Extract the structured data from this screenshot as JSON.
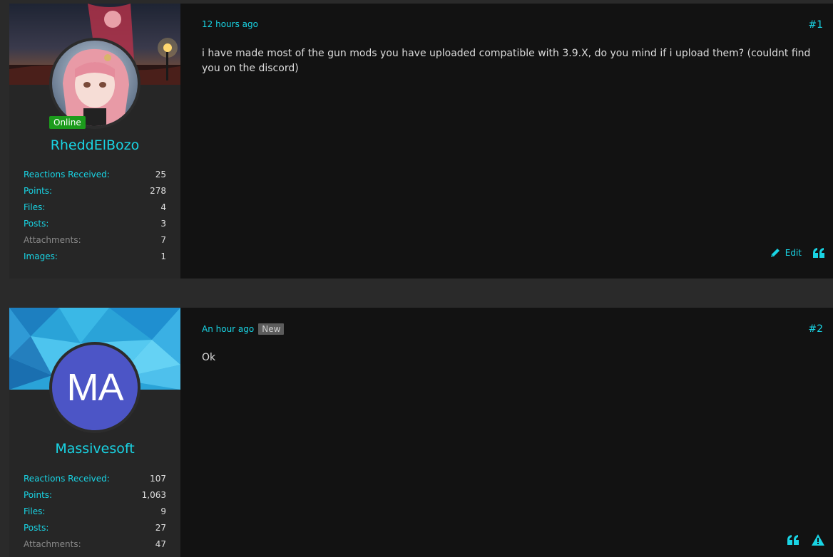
{
  "posts": [
    {
      "user": {
        "name": "RheddElBozo",
        "online_label": "Online",
        "stats": [
          {
            "label": "Reactions Received:",
            "value": "25"
          },
          {
            "label": "Points:",
            "value": "278"
          },
          {
            "label": "Files:",
            "value": "4"
          },
          {
            "label": "Posts:",
            "value": "3"
          },
          {
            "label": "Attachments:",
            "value": "7"
          },
          {
            "label": "Images:",
            "value": "1"
          }
        ]
      },
      "time": "12 hours ago",
      "number": "#1",
      "message": "i have made most of the gun mods you have uploaded compatible with 3.9.X, do you mind if i upload them? (couldnt find you on the discord)",
      "actions": {
        "edit_label": "Edit",
        "edit_icon": "pencil-icon",
        "quote_icon": "quote-icon"
      }
    },
    {
      "user": {
        "name": "Massivesoft",
        "avatar_initials": "MA",
        "avatar_color": "#4c55c6",
        "stats": [
          {
            "label": "Reactions Received:",
            "value": "107"
          },
          {
            "label": "Points:",
            "value": "1,063"
          },
          {
            "label": "Files:",
            "value": "9"
          },
          {
            "label": "Posts:",
            "value": "27"
          },
          {
            "label": "Attachments:",
            "value": "47"
          }
        ]
      },
      "time": "An hour ago",
      "badge": "New",
      "number": "#2",
      "message": "Ok",
      "actions": {
        "quote_icon": "quote-icon",
        "report_icon": "warning-icon"
      }
    }
  ],
  "accent_color": "#19d4e4"
}
